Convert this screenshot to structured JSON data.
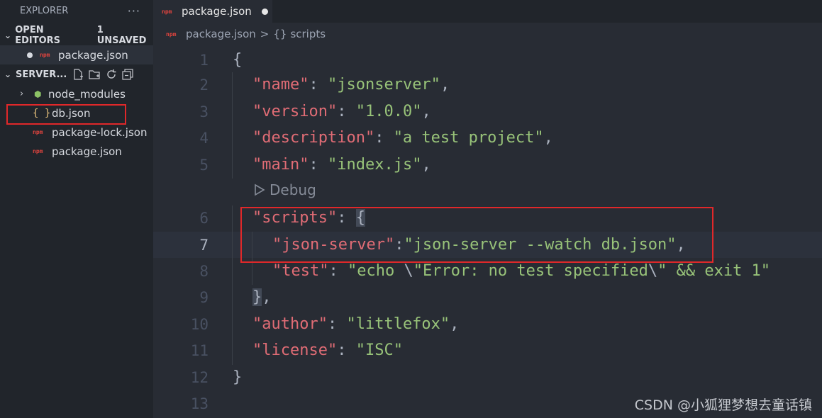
{
  "explorer": {
    "title": "EXPLORER",
    "more": "···",
    "open_editors": {
      "label": "OPEN EDITORS",
      "badge": "1 UNSAVED",
      "items": [
        {
          "icon_text": "npm",
          "label": "package.json",
          "dirty": true
        }
      ]
    },
    "server": {
      "label": "SERVER...",
      "items": [
        {
          "icon": "folder-node-icon",
          "label": "node_modules"
        },
        {
          "icon_text": "{ }",
          "label": "db.json",
          "highlighted": true
        },
        {
          "icon_text": "npm",
          "label": "package-lock.json"
        },
        {
          "icon_text": "npm",
          "label": "package.json"
        }
      ]
    }
  },
  "tab": {
    "icon_text": "npm",
    "label": "package.json",
    "dirty": true
  },
  "breadcrumb": {
    "icon_text": "npm",
    "file": "package.json",
    "sep": ">",
    "symbol_icon": "{}",
    "symbol": "scripts"
  },
  "editor": {
    "current_line": 7,
    "codelens": "Debug",
    "lines": [
      {
        "n": "1",
        "t": "{"
      },
      {
        "n": "2",
        "k": "\"name\"",
        "v": "\"jsonserver\"",
        "e": ","
      },
      {
        "n": "3",
        "k": "\"version\"",
        "v": "\"1.0.0\"",
        "e": ","
      },
      {
        "n": "4",
        "k": "\"description\"",
        "v": "\"a test project\"",
        "e": ","
      },
      {
        "n": "5",
        "k": "\"main\"",
        "v": "\"index.js\"",
        "e": ","
      },
      {
        "n": "6",
        "k": "\"scripts\"",
        "v": "{",
        "e": ""
      },
      {
        "n": "7",
        "k": "\"json-server\"",
        "v": "\"json-server --watch db.json\"",
        "e": ","
      },
      {
        "n": "8",
        "k": "\"test\"",
        "v": "\"echo \\\"Error: no test specified\\\" && exit 1\"",
        "e": ""
      },
      {
        "n": "9",
        "t": "},"
      },
      {
        "n": "10",
        "k": "\"author\"",
        "v": "\"littlefox\"",
        "e": ","
      },
      {
        "n": "11",
        "k": "\"license\"",
        "v": "\"ISC\"",
        "e": ""
      },
      {
        "n": "12",
        "t": "}"
      },
      {
        "n": "13",
        "t": ""
      }
    ]
  },
  "watermark": "CSDN @小狐狸梦想去童话镇",
  "colors": {
    "key": "#e06c75",
    "string": "#98c379",
    "highlight_box": "#e0282a",
    "background": "#282c34",
    "sidebar": "#21252b"
  }
}
